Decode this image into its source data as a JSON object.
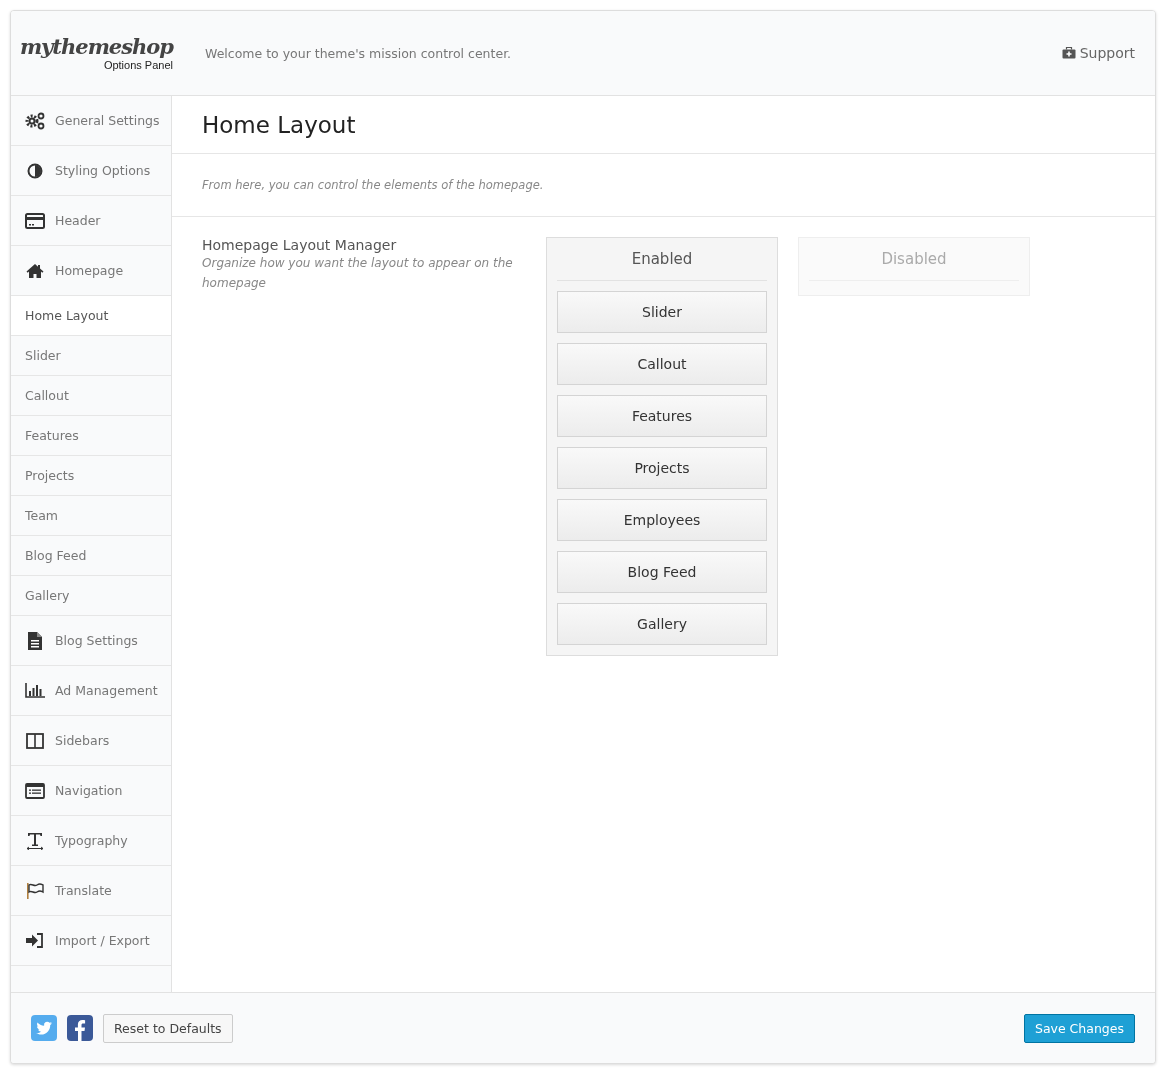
{
  "header": {
    "logo": "mythemeshop",
    "logo_subtitle": "Options Panel",
    "tagline": "Welcome to your theme's mission control center.",
    "support_link": "Support"
  },
  "sidebar": {
    "items": [
      {
        "label": "General Settings",
        "kind": "section",
        "selected": false
      },
      {
        "label": "Styling Options",
        "kind": "section",
        "selected": false
      },
      {
        "label": "Header",
        "kind": "section",
        "selected": false
      },
      {
        "label": "Homepage",
        "kind": "section",
        "selected": false
      },
      {
        "label": "Home Layout",
        "kind": "sub",
        "selected": true
      },
      {
        "label": "Slider",
        "kind": "sub",
        "selected": false
      },
      {
        "label": "Callout",
        "kind": "sub",
        "selected": false
      },
      {
        "label": "Features",
        "kind": "sub",
        "selected": false
      },
      {
        "label": "Projects",
        "kind": "sub",
        "selected": false
      },
      {
        "label": "Team",
        "kind": "sub",
        "selected": false
      },
      {
        "label": "Blog Feed",
        "kind": "sub",
        "selected": false
      },
      {
        "label": "Gallery",
        "kind": "sub",
        "selected": false
      },
      {
        "label": "Blog Settings",
        "kind": "section",
        "selected": false
      },
      {
        "label": "Ad Management",
        "kind": "section",
        "selected": false
      },
      {
        "label": "Sidebars",
        "kind": "section",
        "selected": false
      },
      {
        "label": "Navigation",
        "kind": "section",
        "selected": false
      },
      {
        "label": "Typography",
        "kind": "section",
        "selected": false
      },
      {
        "label": "Translate",
        "kind": "section",
        "selected": false
      },
      {
        "label": "Import / Export",
        "kind": "section",
        "selected": false
      }
    ]
  },
  "main": {
    "title": "Home Layout",
    "description": "From here, you can control the elements of the homepage.",
    "option": {
      "label": "Homepage Layout Manager",
      "help": "Organize how you want the layout to appear on the homepage",
      "columns": [
        {
          "heading": "Enabled",
          "blocks": [
            "Slider",
            "Callout",
            "Features",
            "Projects",
            "Employees",
            "Blog Feed",
            "Gallery"
          ]
        },
        {
          "heading": "Disabled"
        }
      ]
    }
  },
  "footer": {
    "reset_button": "Reset to Defaults",
    "save_button": "Save Changes"
  }
}
